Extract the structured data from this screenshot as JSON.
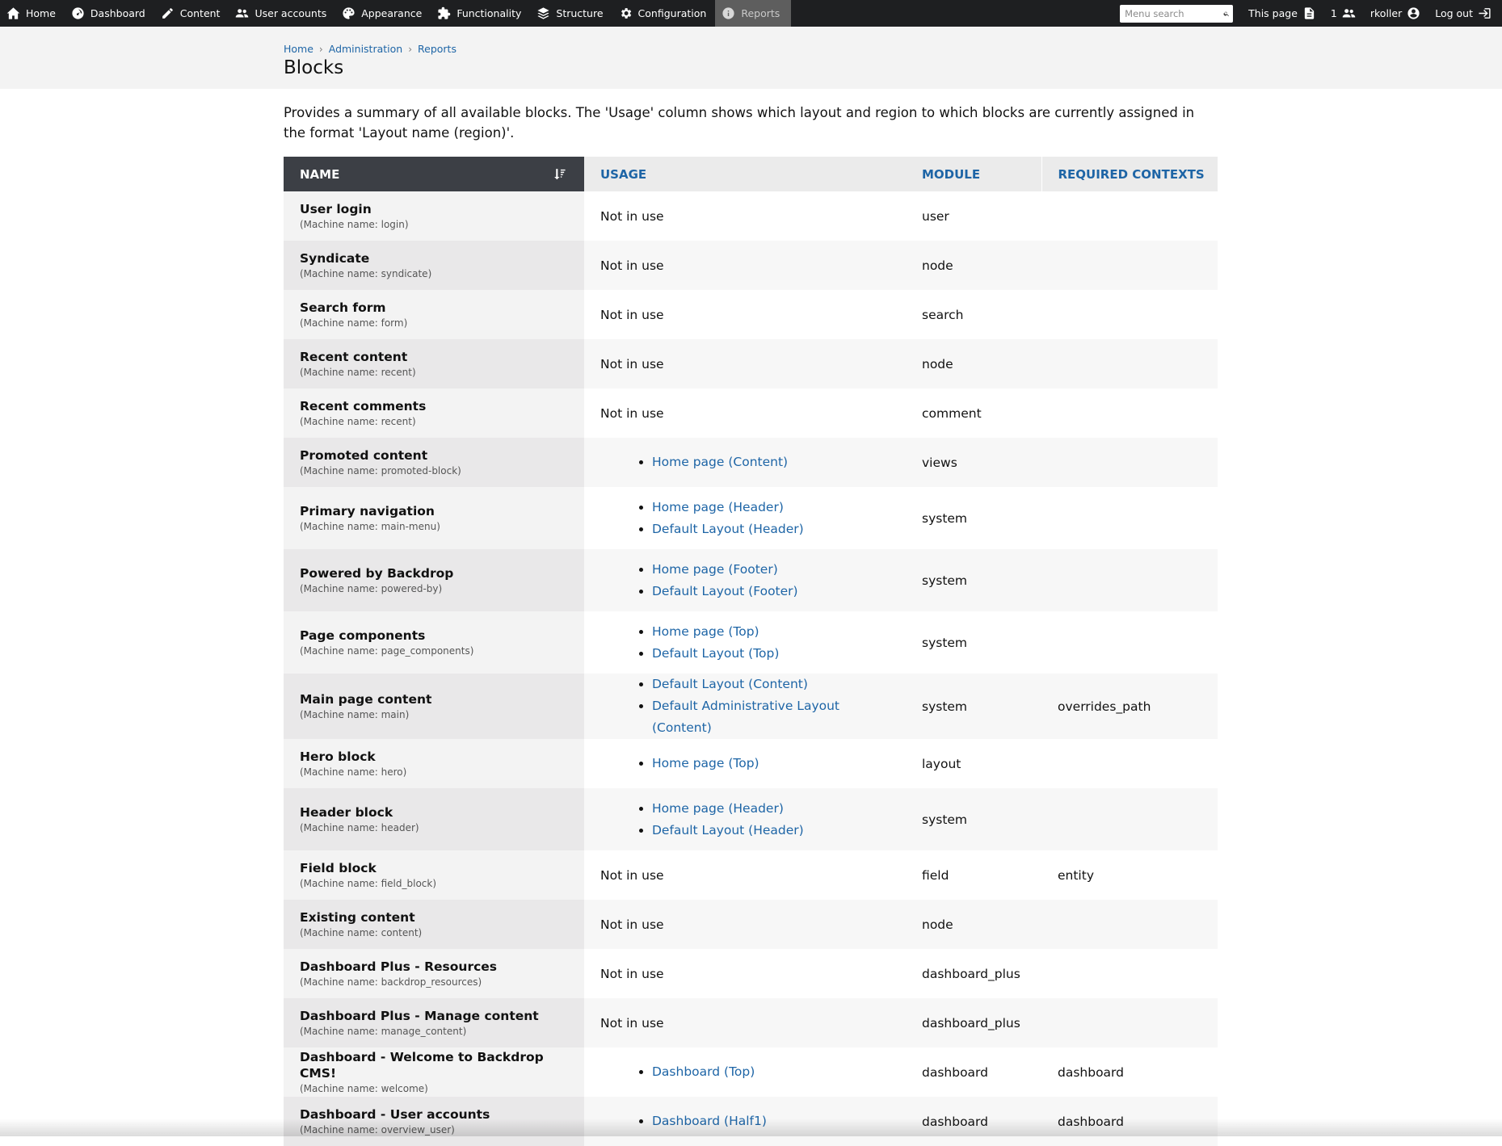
{
  "admin_bar": {
    "items": [
      {
        "label": "Home",
        "icon": "home-icon"
      },
      {
        "label": "Dashboard",
        "icon": "dashboard-icon"
      },
      {
        "label": "Content",
        "icon": "pencil-icon"
      },
      {
        "label": "User accounts",
        "icon": "users-icon"
      },
      {
        "label": "Appearance",
        "icon": "palette-icon"
      },
      {
        "label": "Functionality",
        "icon": "puzzle-icon"
      },
      {
        "label": "Structure",
        "icon": "stack-icon"
      },
      {
        "label": "Configuration",
        "icon": "gear-icon"
      },
      {
        "label": "Reports",
        "icon": "info-icon",
        "active": true
      }
    ],
    "search_placeholder": "Menu search",
    "this_page_label": "This page",
    "users_online": "1",
    "username": "rkoller",
    "logout_label": "Log out"
  },
  "breadcrumb": [
    "Home",
    "Administration",
    "Reports"
  ],
  "page_title": "Blocks",
  "description": "Provides a summary of all available blocks. The 'Usage' column shows which layout and region to which blocks are currently assigned in the format 'Layout name (region)'.",
  "table": {
    "headers": {
      "name": "NAME",
      "usage": "USAGE",
      "module": "MODULE",
      "contexts": "REQUIRED CONTEXTS"
    },
    "rows": [
      {
        "label": "User login",
        "machine": "(Machine name: login)",
        "usage_text": "Not in use",
        "usage": [],
        "module": "user",
        "contexts": ""
      },
      {
        "label": "Syndicate",
        "machine": "(Machine name: syndicate)",
        "usage_text": "Not in use",
        "usage": [],
        "module": "node",
        "contexts": ""
      },
      {
        "label": "Search form",
        "machine": "(Machine name: form)",
        "usage_text": "Not in use",
        "usage": [],
        "module": "search",
        "contexts": ""
      },
      {
        "label": "Recent content",
        "machine": "(Machine name: recent)",
        "usage_text": "Not in use",
        "usage": [],
        "module": "node",
        "contexts": ""
      },
      {
        "label": "Recent comments",
        "machine": "(Machine name: recent)",
        "usage_text": "Not in use",
        "usage": [],
        "module": "comment",
        "contexts": ""
      },
      {
        "label": "Promoted content",
        "machine": "(Machine name: promoted-block)",
        "usage_text": "",
        "usage": [
          "Home page (Content)"
        ],
        "module": "views",
        "contexts": ""
      },
      {
        "label": "Primary navigation",
        "machine": "(Machine name: main-menu)",
        "usage_text": "",
        "usage": [
          "Home page (Header)",
          "Default Layout (Header)"
        ],
        "module": "system",
        "contexts": ""
      },
      {
        "label": "Powered by Backdrop",
        "machine": "(Machine name: powered-by)",
        "usage_text": "",
        "usage": [
          "Home page (Footer)",
          "Default Layout (Footer)"
        ],
        "module": "system",
        "contexts": ""
      },
      {
        "label": "Page components",
        "machine": "(Machine name: page_components)",
        "usage_text": "",
        "usage": [
          "Home page (Top)",
          "Default Layout (Top)"
        ],
        "module": "system",
        "contexts": ""
      },
      {
        "label": "Main page content",
        "machine": "(Machine name: main)",
        "usage_text": "",
        "usage": [
          "Default Layout (Content)",
          "Default Administrative Layout (Content)"
        ],
        "module": "system",
        "contexts": "overrides_path"
      },
      {
        "label": "Hero block",
        "machine": "(Machine name: hero)",
        "usage_text": "",
        "usage": [
          "Home page (Top)"
        ],
        "module": "layout",
        "contexts": ""
      },
      {
        "label": "Header block",
        "machine": "(Machine name: header)",
        "usage_text": "",
        "usage": [
          "Home page (Header)",
          "Default Layout (Header)"
        ],
        "module": "system",
        "contexts": ""
      },
      {
        "label": "Field block",
        "machine": "(Machine name: field_block)",
        "usage_text": "Not in use",
        "usage": [],
        "module": "field",
        "contexts": "entity"
      },
      {
        "label": "Existing content",
        "machine": "(Machine name: content)",
        "usage_text": "Not in use",
        "usage": [],
        "module": "node",
        "contexts": ""
      },
      {
        "label": "Dashboard Plus - Resources",
        "machine": "(Machine name: backdrop_resources)",
        "usage_text": "Not in use",
        "usage": [],
        "module": "dashboard_plus",
        "contexts": ""
      },
      {
        "label": "Dashboard Plus - Manage content",
        "machine": "(Machine name: manage_content)",
        "usage_text": "Not in use",
        "usage": [],
        "module": "dashboard_plus",
        "contexts": ""
      },
      {
        "label": "Dashboard - Welcome to Backdrop CMS!",
        "machine": "(Machine name: welcome)",
        "usage_text": "",
        "usage": [
          "Dashboard (Top)"
        ],
        "module": "dashboard",
        "contexts": "dashboard"
      },
      {
        "label": "Dashboard - User accounts",
        "machine": "(Machine name: overview_user)",
        "usage_text": "",
        "usage": [
          "Dashboard (Half1)"
        ],
        "module": "dashboard",
        "contexts": "dashboard"
      }
    ]
  }
}
